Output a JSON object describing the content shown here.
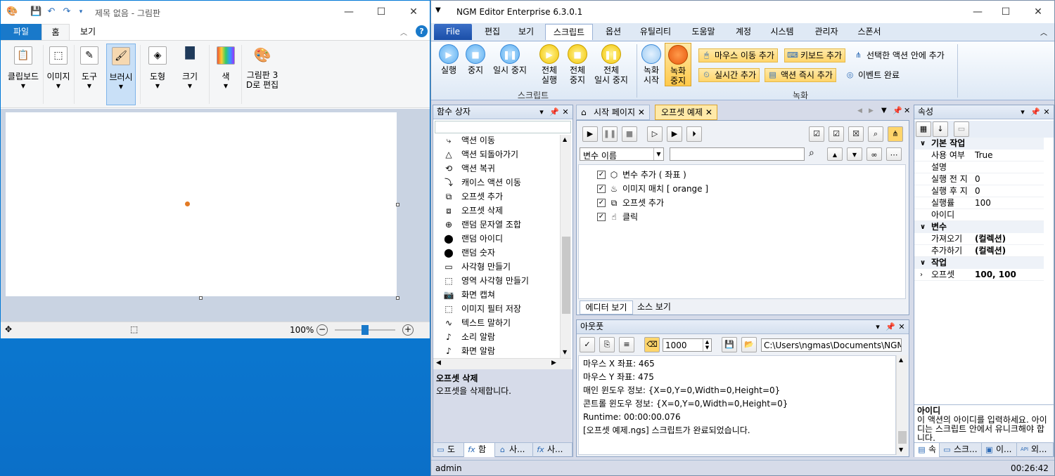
{
  "paint": {
    "title": "제목 없음 - 그림판",
    "tabs": [
      "파일",
      "홈",
      "보기"
    ],
    "groups": [
      "클립보드",
      "이미지",
      "도구",
      "브러시",
      "도형",
      "크기",
      "색",
      "그림판 3\nD로 편집"
    ],
    "zoom": "100%",
    "zoom_level": 0.5
  },
  "ngm": {
    "title": "NGM Editor   Enterprise 6.3.0.1",
    "menu": [
      "File",
      "편집",
      "보기",
      "스크립트",
      "옵션",
      "유틸리티",
      "도움말",
      "계정",
      "시스템",
      "관리자",
      "스폰서"
    ],
    "ribbon": {
      "run": "실행",
      "stop": "중지",
      "pause": "일시 중지",
      "run_all": "전체\n실행",
      "stop_all": "전체\n중지",
      "pause_all": "전체\n일시 중지",
      "script_group": "스크립트",
      "rec_start": "녹화\n시작",
      "rec_stop": "녹화\n중지",
      "add_mouse": "마우스 이동 추가",
      "add_keyboard": "키보드 추가",
      "add_in_selected": "선택한 액션 안에 추가",
      "add_realtime": "실시간 추가",
      "add_action_now": "액션 즉시 추가",
      "event_done": "이벤트 완료",
      "record_group": "녹화"
    },
    "func_panel": {
      "title": "함수 상자",
      "items": [
        "액션 이동",
        "액션 되돌아가기",
        "액션 복귀",
        "캐이스 액션 이동",
        "오프셋 추가",
        "오프셋 삭제",
        "랜덤 문자열 조합",
        "랜덤 아이디",
        "랜덤 숫자",
        "사각형 만들기",
        "영역 사각형 만들기",
        "화면 캡쳐",
        "이미지 필터 저장",
        "텍스트 말하기",
        "소리 알람",
        "화면 알람"
      ],
      "desc_title": "오프셋 삭제",
      "desc_text": "오프셋을 삭제합니다.",
      "bottom_tabs": [
        "도",
        "함",
        "사...",
        "사..."
      ]
    },
    "doc": {
      "tabs": [
        "시작 페이지",
        "오프셋 예제"
      ],
      "var_select": "변수 이름",
      "tree": [
        "변수 추가 ( 좌표 )",
        "이미지 매치 [ orange ]",
        "오프셋 추가",
        "클릭"
      ],
      "view_tabs": [
        "에디터 보기",
        "소스 보기"
      ]
    },
    "output": {
      "title": "아웃풋",
      "count": "1000",
      "path": "C:\\Users\\ngmas\\Documents\\NGM6\\",
      "lines": [
        "마우스 X 좌표: 465",
        "마우스 Y 좌표: 475",
        "매인 윈도우 정보: {X=0,Y=0,Width=0,Height=0}",
        "콘트롤 윈도우 정보: {X=0,Y=0,Width=0,Height=0}",
        "Runtime: 00:00:00.076",
        "[오프셋 예제.ngs] 스크립트가 완료되었습니다."
      ]
    },
    "props": {
      "title": "속성",
      "cat_basic": "기본 작업",
      "use": "사용 여부",
      "use_v": "True",
      "desc": "설명",
      "before": "실행 전 지",
      "before_v": "0",
      "after": "실행 후 지",
      "after_v": "0",
      "rate": "실행률",
      "rate_v": "100",
      "id": "아이디",
      "cat_var": "변수",
      "get": "가져오기",
      "get_v": "(컬렉션)",
      "add": "추가하기",
      "add_v": "(컬렉션)",
      "cat_work": "작업",
      "offset": "오프셋",
      "offset_v": "100, 100",
      "help_title": "아이디",
      "help_text": "이 액션의 아이디를 입력하세요. 아이디는 스크립트 안에서 유니크해야 합니다.",
      "bottom_tabs": [
        "속",
        "스크...",
        "이...",
        "외..."
      ]
    },
    "status": {
      "user": "admin",
      "time": "00:26:42"
    }
  }
}
